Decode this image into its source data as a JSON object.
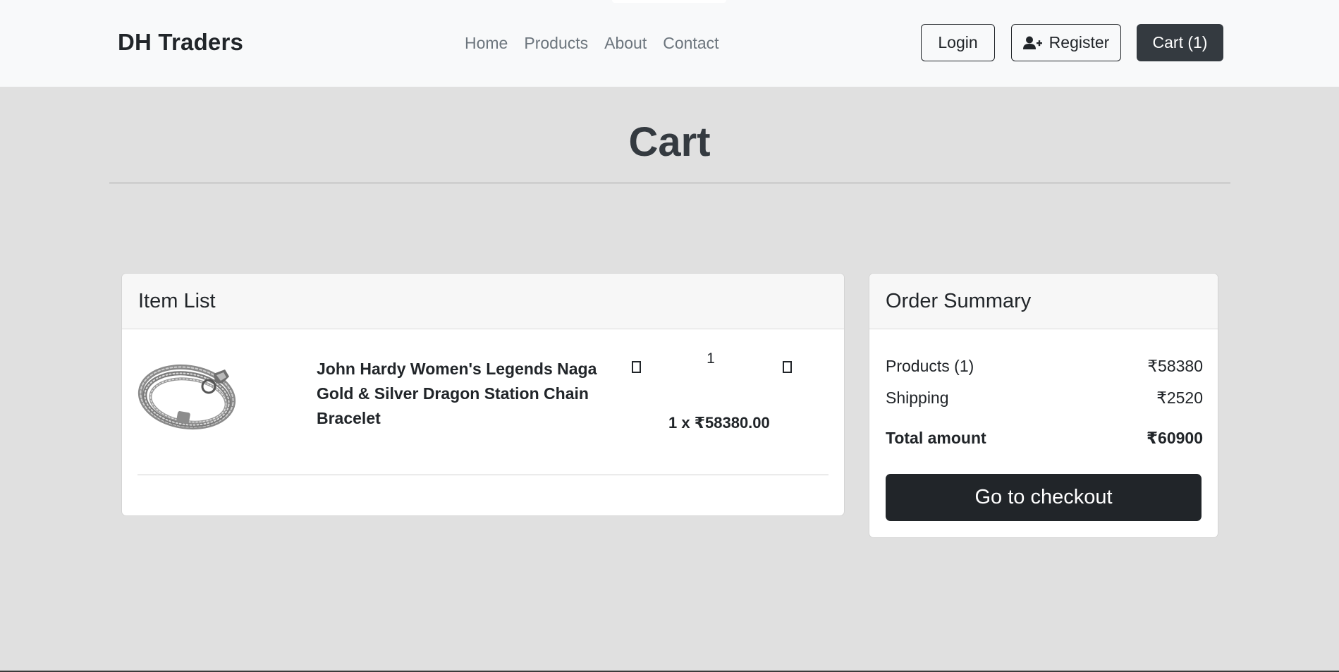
{
  "navbar": {
    "brand": "DH Traders",
    "links": [
      "Home",
      "Products",
      "About",
      "Contact"
    ],
    "login_label": "Login",
    "register_label": "Register",
    "cart_label": "Cart (1)"
  },
  "page": {
    "title": "Cart"
  },
  "item_list": {
    "header": "Item List",
    "items": [
      {
        "name": "John Hardy Women's Legends Naga Gold & Silver Dragon Station Chain Bracelet",
        "quantity": "1",
        "price_line": "1 x ₹58380.00",
        "image_icon": "bracelet-image"
      }
    ]
  },
  "order_summary": {
    "header": "Order Summary",
    "products_label": "Products (1)",
    "products_value": "₹58380",
    "shipping_label": "Shipping",
    "shipping_value": "₹2520",
    "total_label": "Total amount",
    "total_value": "₹60900",
    "checkout_label": "Go to checkout"
  },
  "colors": {
    "page_bg": "#e0e0e0",
    "navbar_bg": "#f8f9fa",
    "dark": "#212529",
    "muted": "#6c757d"
  }
}
